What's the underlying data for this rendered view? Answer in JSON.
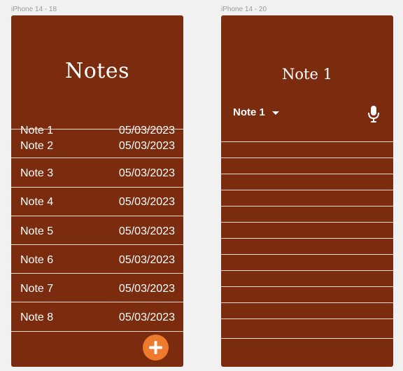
{
  "frames": [
    {
      "label": "iPhone 14 - 18"
    },
    {
      "label": "iPhone 14 - 20"
    }
  ],
  "notes_list": {
    "title": "Notes",
    "items": [
      {
        "name": "Note 1",
        "date": "05/03/2023"
      },
      {
        "name": "Note 2",
        "date": "05/03/2023"
      },
      {
        "name": "Note 3",
        "date": "05/03/2023"
      },
      {
        "name": "Note 4",
        "date": "05/03/2023"
      },
      {
        "name": "Note 5",
        "date": "05/03/2023"
      },
      {
        "name": "Note 6",
        "date": "05/03/2023"
      },
      {
        "name": "Note 7",
        "date": "05/03/2023"
      },
      {
        "name": "Note 8",
        "date": "05/03/2023"
      }
    ],
    "add_button_icon": "plus-icon"
  },
  "note_editor": {
    "title": "Note 1",
    "selector_value": "Note 1",
    "selector_icon": "caret-down-icon",
    "mic_icon": "microphone-icon"
  },
  "colors": {
    "background": "#f1f1f1",
    "panel": "#7b2c0e",
    "accent": "#ee7a2e",
    "text": "#ffffff"
  }
}
